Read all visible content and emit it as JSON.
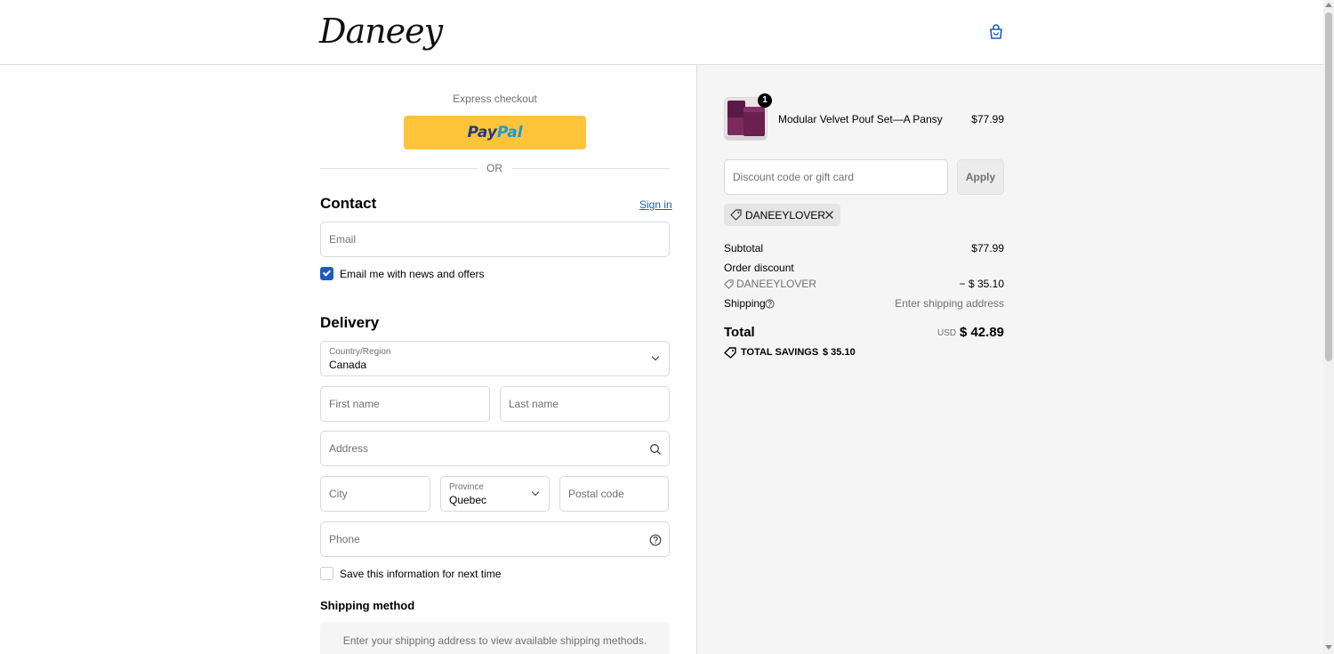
{
  "header": {
    "logo_text": "Daneey",
    "cart_icon": "bag-icon"
  },
  "express": {
    "title": "Express checkout",
    "paypal_a": "Pay",
    "paypal_b": "Pal",
    "or_label": "OR"
  },
  "contact": {
    "title": "Contact",
    "sign_in": "Sign in",
    "email_placeholder": "Email",
    "news_checkbox_label": "Email me with news and offers",
    "news_checked": true
  },
  "delivery": {
    "title": "Delivery",
    "country_label": "Country/Region",
    "country_value": "Canada",
    "first_name_placeholder": "First name",
    "last_name_placeholder": "Last name",
    "address_placeholder": "Address",
    "city_placeholder": "City",
    "province_label": "Province",
    "province_value": "Quebec",
    "postal_placeholder": "Postal code",
    "phone_placeholder": "Phone",
    "save_checkbox_label": "Save this information for next time",
    "save_checked": false
  },
  "shipping_method": {
    "title": "Shipping method",
    "message": "Enter your shipping address to view available shipping methods."
  },
  "summary": {
    "item": {
      "quantity": "1",
      "name": "Modular Velvet Pouf Set—A Pansy",
      "price": "$77.99"
    },
    "discount_placeholder": "Discount code or gift card",
    "apply_label": "Apply",
    "applied_code": "DANEEYLOVER",
    "subtotal_label": "Subtotal",
    "subtotal_value": "$77.99",
    "order_discount_label": "Order discount",
    "discount_code": "DANEEYLOVER",
    "discount_value": "− $ 35.10",
    "shipping_label": "Shipping",
    "shipping_value": "Enter shipping address",
    "total_label": "Total",
    "currency": "USD",
    "total_value": "$ 42.89",
    "savings_label": "TOTAL SAVINGS",
    "savings_value": "$ 35.10"
  },
  "colors": {
    "accent": "#1a5bbf",
    "paypal_yellow": "#ffc439",
    "summary_bg": "#f5f5f5",
    "product_purple": "#6b1f4e"
  }
}
